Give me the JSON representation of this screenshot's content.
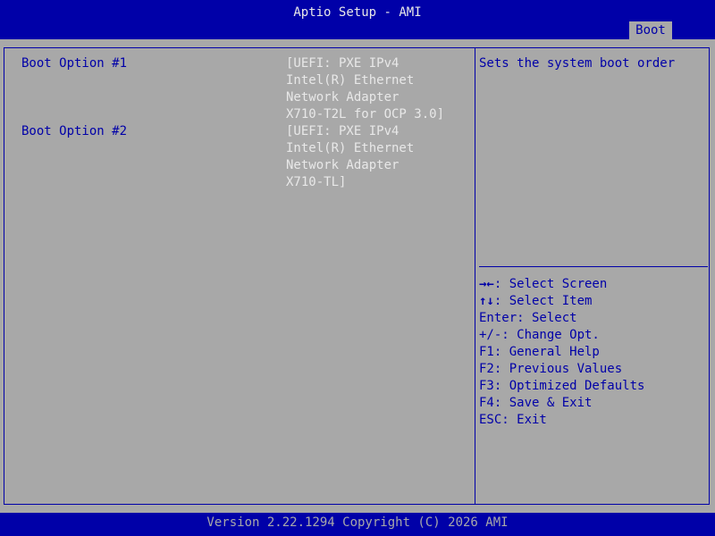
{
  "header": {
    "title": "Aptio Setup - AMI",
    "active_tab": "Boot"
  },
  "boot_options": [
    {
      "label": "Boot Option #1",
      "value_lines": [
        "[UEFI: PXE IPv4",
        "Intel(R) Ethernet",
        "Network Adapter",
        "X710-T2L for OCP 3.0]"
      ]
    },
    {
      "label": "Boot Option #2",
      "value_lines": [
        "[UEFI: PXE IPv4",
        "Intel(R) Ethernet",
        "Network Adapter",
        "X710-TL]"
      ]
    }
  ],
  "help_text": "Sets the system boot order",
  "key_help": [
    {
      "key": "→←",
      "desc": ": Select Screen"
    },
    {
      "key": "↑↓",
      "desc": ": Select Item"
    },
    {
      "key": "",
      "desc": "Enter: Select"
    },
    {
      "key": "",
      "desc": "+/-: Change Opt."
    },
    {
      "key": "",
      "desc": "F1: General Help"
    },
    {
      "key": "",
      "desc": "F2: Previous Values"
    },
    {
      "key": "",
      "desc": "F3: Optimized Defaults"
    },
    {
      "key": "",
      "desc": "F4: Save & Exit"
    },
    {
      "key": "",
      "desc": "ESC: Exit"
    }
  ],
  "footer": {
    "version": "Version 2.22.1294 Copyright (C) 2026 AMI"
  },
  "colors": {
    "background": "#a8a8a8",
    "bar": "#0000a8",
    "text_white": "#e8e8e8"
  }
}
